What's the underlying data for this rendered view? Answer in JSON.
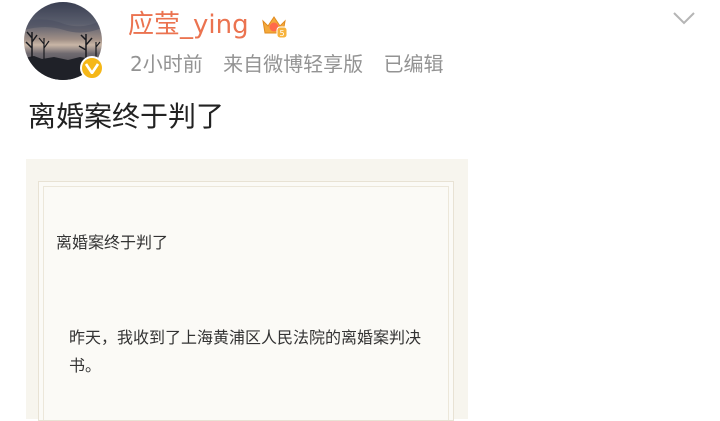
{
  "post": {
    "username": "应莹_ying",
    "time": "2小时前",
    "source": "来自微博轻享版",
    "edited": "已编辑",
    "text": "离婚案终于判了",
    "card": {
      "title": "离婚案终于判了",
      "body": "昨天，我收到了上海黄浦区人民法院的离婚案判决书。"
    }
  },
  "colors": {
    "username": "#eb7350",
    "meta": "#939393",
    "verified": "#f5b718"
  },
  "icons": {
    "verified": "verified-badge-icon",
    "member": "crown-member-icon",
    "menu": "chevron-down-icon"
  }
}
